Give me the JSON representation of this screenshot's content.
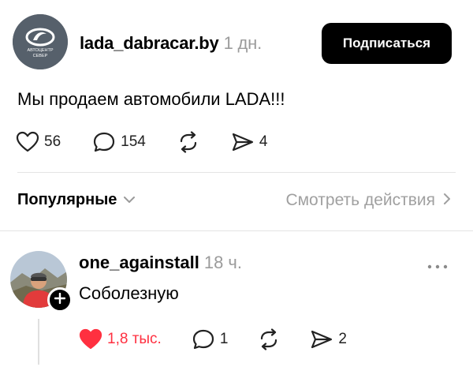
{
  "post": {
    "author": "lada_dabracar.by",
    "time": "1 дн.",
    "avatar_brand": "АВТОЦЕНТР",
    "avatar_sub": "СЕВЕР",
    "subscribe_label": "Подписаться",
    "text": "Мы продаем автомобили LADA!!!",
    "likes": "56",
    "comments": "154",
    "shares": "4",
    "icons": [
      "heart-icon",
      "comment-icon",
      "repost-icon",
      "send-icon"
    ]
  },
  "filter": {
    "sort_label": "Популярные",
    "view_actions_label": "Смотреть действия"
  },
  "comment": {
    "author": "one_againstall",
    "time": "18 ч.",
    "text": "Соболезную",
    "likes": "1,8 тыс.",
    "replies": "1",
    "shares": "2",
    "like_color": "#ff3040"
  }
}
